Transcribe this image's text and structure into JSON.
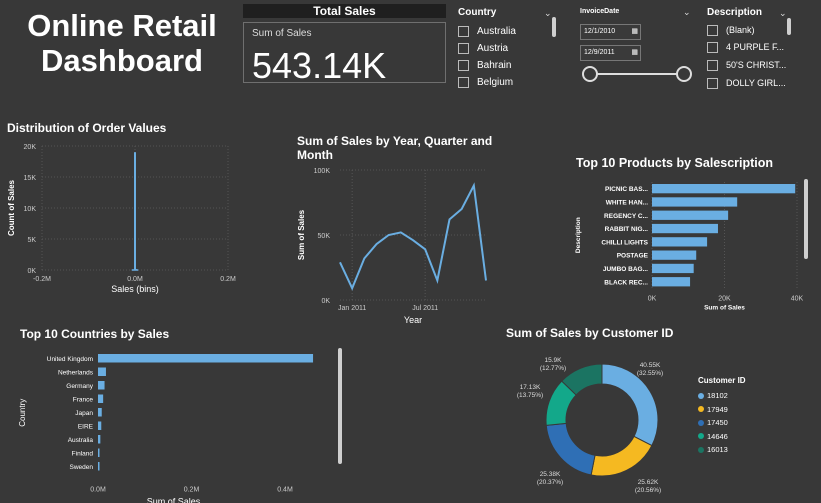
{
  "dashboard": {
    "title": "Online Retail Dashboard"
  },
  "kpi": {
    "header": "Total Sales",
    "label": "Sum of Sales",
    "value": "543.14K"
  },
  "country_slicer": {
    "title": "Country",
    "items": [
      "Australia",
      "Austria",
      "Bahrain",
      "Belgium"
    ]
  },
  "date_slicer": {
    "title": "InvoiceDate",
    "start": "12/1/2010",
    "end": "12/9/2011",
    "range_fraction": [
      0,
      1
    ]
  },
  "description_slicer": {
    "title": "Description",
    "items": [
      "(Blank)",
      "4 PURPLE F...",
      "50'S CHRIST...",
      "DOLLY GIRL..."
    ]
  },
  "colors": {
    "bar": "#6aaee2",
    "background": "#383838",
    "donut": [
      "#6aaee2",
      "#f5b921",
      "#2f6fb5",
      "#13a88a",
      "#1b7462"
    ]
  },
  "chart_data": [
    {
      "id": "distribution",
      "type": "bar",
      "title": "Distribution of Order Values",
      "xlabel": "Sales (bins)",
      "ylabel": "Count of Sales",
      "xticks": [
        "-0.2M",
        "0.0M",
        "0.2M"
      ],
      "yticks": [
        "0K",
        "5K",
        "10K",
        "15K",
        "20K"
      ],
      "xlim": [
        -0.2,
        0.2
      ],
      "ylim": [
        0,
        20000
      ],
      "bins": [
        {
          "x": 0.0,
          "count": 19000
        },
        {
          "x": 0.002,
          "count": 150
        }
      ],
      "grid": true
    },
    {
      "id": "sales_by_month",
      "type": "line",
      "title": "Sum of Sales by Year, Quarter and Month",
      "xlabel": "Year",
      "ylabel": "Sum of Sales",
      "xticks": [
        "Jan 2011",
        "Jul 2011"
      ],
      "yticks": [
        "0K",
        "50K",
        "100K"
      ],
      "ylim": [
        0,
        100000
      ],
      "x": [
        "Dec 2010",
        "Jan 2011",
        "Feb 2011",
        "Mar 2011",
        "Apr 2011",
        "May 2011",
        "Jun 2011",
        "Jul 2011",
        "Aug 2011",
        "Sep 2011",
        "Oct 2011",
        "Nov 2011",
        "Dec 2011"
      ],
      "values": [
        29000,
        9000,
        32000,
        43000,
        50000,
        52000,
        46000,
        39000,
        15000,
        62000,
        70000,
        88000,
        15000
      ],
      "grid": true
    },
    {
      "id": "top_products",
      "type": "bar",
      "orientation": "horizontal",
      "title": "Top 10 Products by Salescription",
      "xlabel": "Sum of Sales",
      "ylabel": "Description",
      "xticks": [
        "0K",
        "20K",
        "40K"
      ],
      "xlim": [
        0,
        40000
      ],
      "categories": [
        "PICNIC BAS...",
        "WHITE HAN...",
        "REGENCY C...",
        "RABBIT NIG...",
        "CHILLI LIGHTS",
        "POSTAGE",
        "JUMBO BAG...",
        "BLACK REC..."
      ],
      "values": [
        39500,
        23500,
        21000,
        18200,
        15200,
        12200,
        11500,
        10500
      ],
      "grid": true
    },
    {
      "id": "top_countries",
      "type": "bar",
      "orientation": "horizontal",
      "title": "Top 10 Countries by Sales",
      "xlabel": "Sum of Sales",
      "ylabel": "Country",
      "xticks": [
        "0.0M",
        "0.2M",
        "0.4M"
      ],
      "xlim": [
        0,
        0.4
      ],
      "categories": [
        "United Kingdom",
        "Netherlands",
        "Germany",
        "France",
        "Japan",
        "EIRE",
        "Australia",
        "Finland",
        "Sweden"
      ],
      "values": [
        0.46,
        0.017,
        0.014,
        0.011,
        0.008,
        0.007,
        0.005,
        0.003,
        0.002
      ],
      "grid": false
    },
    {
      "id": "sales_by_customer",
      "type": "pie",
      "donut": true,
      "title": "Sum of Sales by Customer ID",
      "legend_title": "Customer ID",
      "legend_position": "right",
      "categories": [
        "18102",
        "17949",
        "17450",
        "14646",
        "16013"
      ],
      "values": [
        40550,
        25620,
        25380,
        17130,
        15900
      ],
      "labels": [
        "40.55K (32.55%)",
        "25.62K (20.56%)",
        "25.38K (20.37%)",
        "17.13K (13.75%)",
        "15.9K (12.77%)"
      ]
    }
  ]
}
